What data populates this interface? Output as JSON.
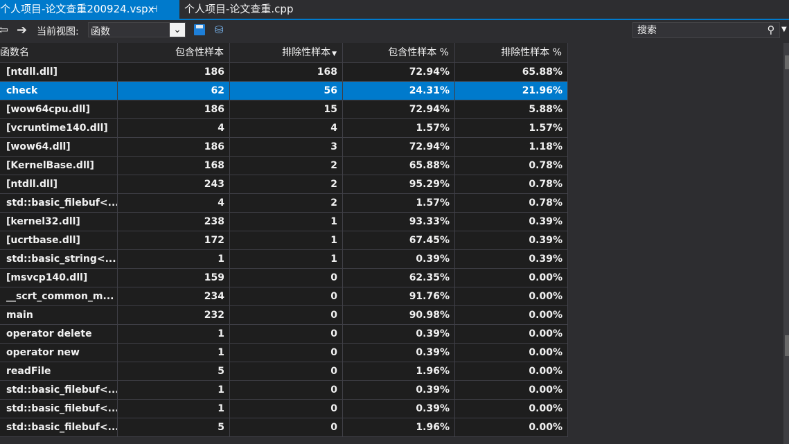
{
  "tabs": {
    "active_label": "个人项目-论文查重200924.vspx",
    "pin_glyph": "⊣",
    "inactive_label": "个人项目-论文查重.cpp"
  },
  "toolbar": {
    "current_view_label": "当前视图:",
    "current_view_value": "函数",
    "search_placeholder": "搜索",
    "back_icon": "arrow-left",
    "forward_icon": "arrow-right",
    "save_icon": "save",
    "share_icon": "export"
  },
  "columns": [
    "函数名",
    "包含性样本",
    "排除性样本",
    "包含性样本 %",
    "排除性样本 %"
  ],
  "sorted_column": "排除性样本",
  "sort_direction": "descending",
  "selected_row": 1,
  "selection_color": "#007acc",
  "rows": [
    [
      "[ntdll.dll]",
      "186",
      "168",
      "72.94%",
      "65.88%"
    ],
    [
      "check",
      "62",
      "56",
      "24.31%",
      "21.96%"
    ],
    [
      "[wow64cpu.dll]",
      "186",
      "15",
      "72.94%",
      "5.88%"
    ],
    [
      "[vcruntime140.dll]",
      "4",
      "4",
      "1.57%",
      "1.57%"
    ],
    [
      "[wow64.dll]",
      "186",
      "3",
      "72.94%",
      "1.18%"
    ],
    [
      "[KernelBase.dll]",
      "168",
      "2",
      "65.88%",
      "0.78%"
    ],
    [
      "[ntdll.dll]",
      "243",
      "2",
      "95.29%",
      "0.78%"
    ],
    [
      "std::basic_filebuf<...",
      "4",
      "2",
      "1.57%",
      "0.78%"
    ],
    [
      "[kernel32.dll]",
      "238",
      "1",
      "93.33%",
      "0.39%"
    ],
    [
      "[ucrtbase.dll]",
      "172",
      "1",
      "67.45%",
      "0.39%"
    ],
    [
      "std::basic_string<...",
      "1",
      "1",
      "0.39%",
      "0.39%"
    ],
    [
      "[msvcp140.dll]",
      "159",
      "0",
      "62.35%",
      "0.00%"
    ],
    [
      "__scrt_common_m...",
      "234",
      "0",
      "91.76%",
      "0.00%"
    ],
    [
      "main",
      "232",
      "0",
      "90.98%",
      "0.00%"
    ],
    [
      "operator delete",
      "1",
      "0",
      "0.39%",
      "0.00%"
    ],
    [
      "operator new",
      "1",
      "0",
      "0.39%",
      "0.00%"
    ],
    [
      "readFile",
      "5",
      "0",
      "1.96%",
      "0.00%"
    ],
    [
      "std::basic_filebuf<...",
      "1",
      "0",
      "0.39%",
      "0.00%"
    ],
    [
      "std::basic_filebuf<...",
      "1",
      "0",
      "0.39%",
      "0.00%"
    ],
    [
      "std::basic_filebuf<...",
      "5",
      "0",
      "1.96%",
      "0.00%"
    ]
  ]
}
